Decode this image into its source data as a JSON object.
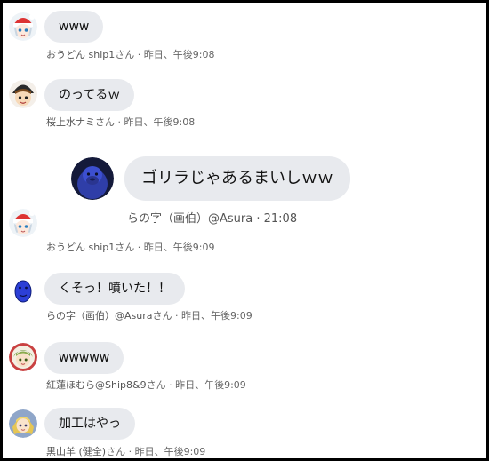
{
  "messages": [
    {
      "text": "www",
      "name": "おうどん ship1",
      "suffix": "さん",
      "time": " · 昨日、午後9:08",
      "avatar": "santa-hat-character-avatar"
    },
    {
      "text": "のってるｗ",
      "name": "桜上水ナミ",
      "suffix": "さん",
      "time": " · 昨日、午後9:08",
      "avatar": "helmet-character-avatar"
    },
    {
      "text": "",
      "name": "おうどん ship1",
      "suffix": "さん",
      "time": " · 昨日、午後9:09",
      "avatar": "santa-hat-character-avatar"
    },
    {
      "text": "くそっ！噴いた！！",
      "name": "らの字（画伯）@Asura",
      "suffix": "さん",
      "time": " · 昨日、午後9:09",
      "avatar": "blue-face-avatar"
    },
    {
      "text": "wwwww",
      "name": "紅蓮ほむら@Ship8&9",
      "suffix": "さん",
      "time": " · 昨日、午後9:09",
      "avatar": "green-hair-character-avatar"
    },
    {
      "text": "加工はやっ",
      "name": "黒山羊 (健全)",
      "suffix": "さん",
      "time": " · 昨日、午後9:09",
      "avatar": "blonde-character-avatar"
    }
  ],
  "embedded": {
    "text": "ゴリラじゃあるまいしｗｗ",
    "author": "らの字（画伯）@Asura",
    "time": "· 21:08",
    "avatar": "gorilla-avatar"
  }
}
